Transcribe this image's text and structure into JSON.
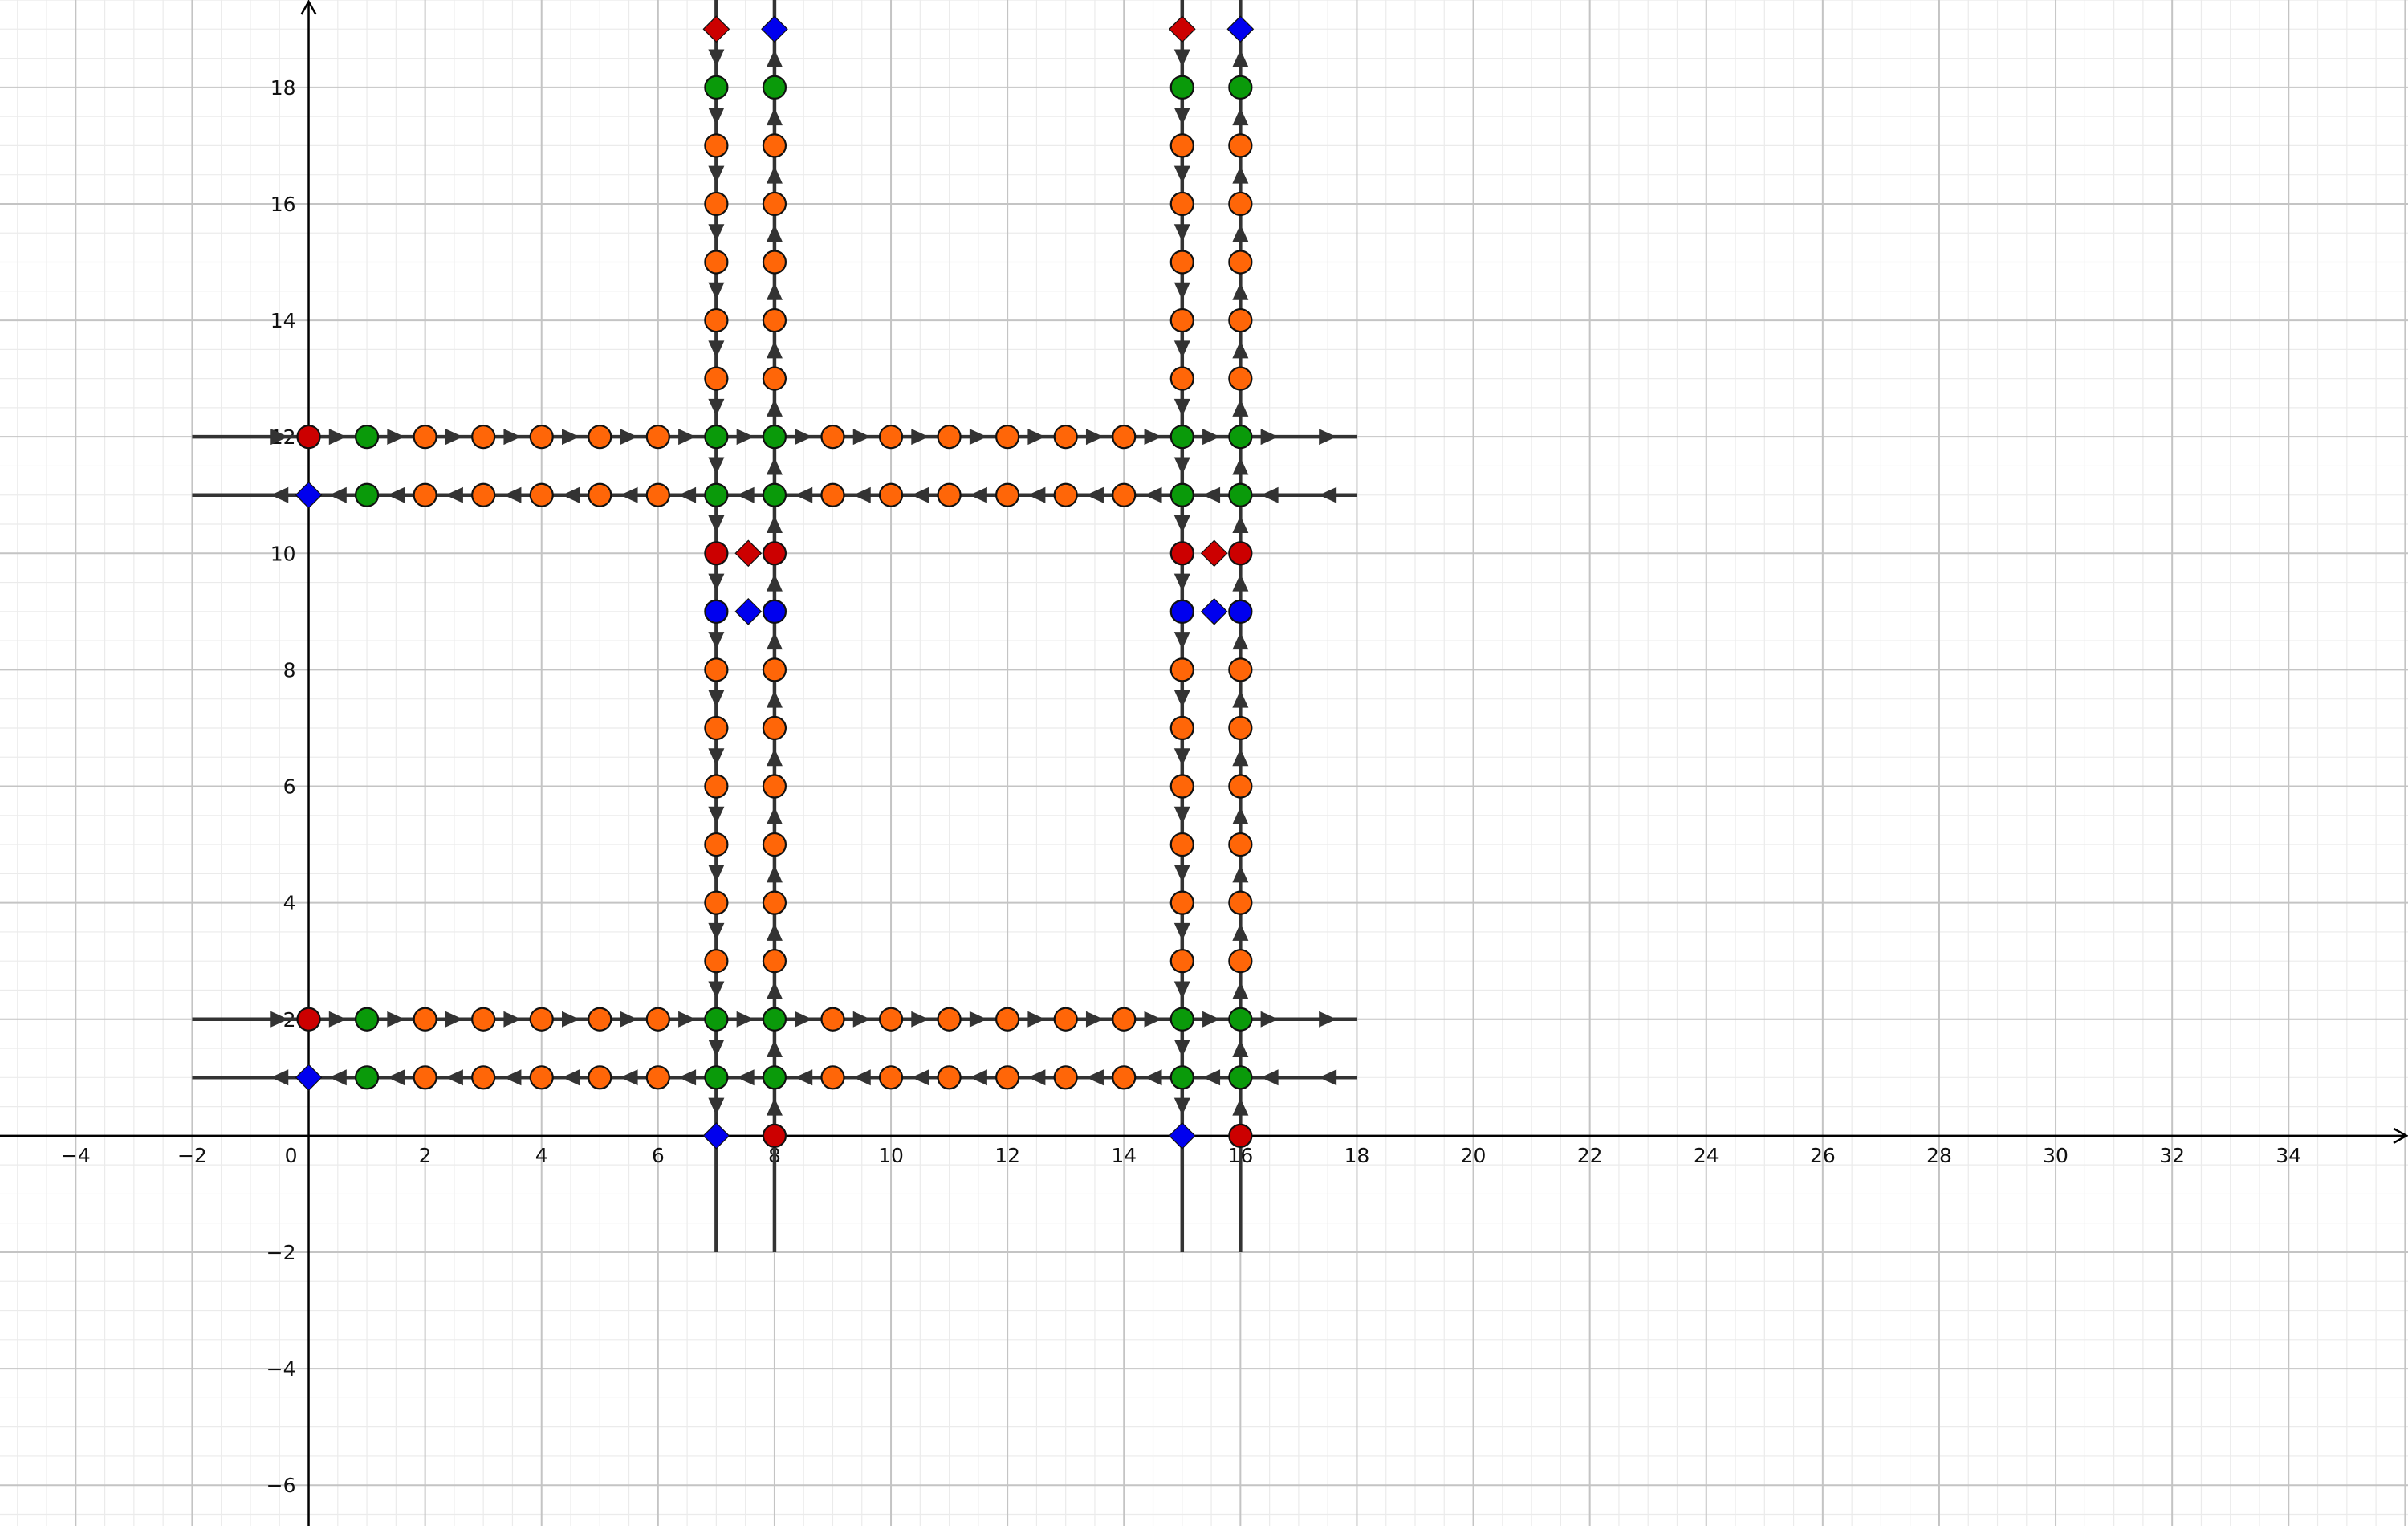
{
  "view": {
    "x_range": [
      -5.3,
      36.05
    ],
    "y_range": [
      -6.7,
      19.5
    ]
  },
  "axes": {
    "x_ticks": [
      -4,
      -2,
      0,
      2,
      4,
      6,
      8,
      10,
      12,
      14,
      16,
      18,
      20,
      22,
      24,
      26,
      28,
      30,
      32,
      34
    ],
    "y_ticks": [
      -6,
      -4,
      -2,
      2,
      4,
      6,
      8,
      10,
      12,
      14,
      16,
      18
    ],
    "x_tick_labels": [
      "−4",
      "−2",
      "0",
      "2",
      "4",
      "6",
      "8",
      "10",
      "12",
      "14",
      "16",
      "18",
      "20",
      "22",
      "24",
      "26",
      "28",
      "30",
      "32",
      "34"
    ],
    "y_tick_labels": [
      "−6",
      "−4",
      "−2",
      "2",
      "4",
      "6",
      "8",
      "10",
      "12",
      "14",
      "16",
      "18"
    ],
    "major_grid": 2,
    "minor_grid": 0.5
  },
  "colors": {
    "background": "#ffffff",
    "minor_grid": "#ebebeb",
    "major_grid": "#c4c4c4",
    "axis": "#000000",
    "road": "#333333",
    "arrow": "#333333",
    "node_orange": "#ff6608",
    "node_green": "#0a9a0a",
    "node_red": "#cc0000",
    "node_blue": "#0000ee",
    "node_outline": "#111111"
  },
  "roads": {
    "horizontal": [
      {
        "y": 12,
        "x_from": -2,
        "x_to": 18,
        "direction": "east"
      },
      {
        "y": 11,
        "x_from": -2,
        "x_to": 18,
        "direction": "west"
      },
      {
        "y": 2,
        "x_from": -2,
        "x_to": 18,
        "direction": "east"
      },
      {
        "y": 1,
        "x_from": -2,
        "x_to": 18,
        "direction": "west"
      }
    ],
    "vertical": [
      {
        "x": 7,
        "y_from": -2,
        "y_to": 19.5,
        "direction": "south"
      },
      {
        "x": 8,
        "y_from": -2,
        "y_to": 19.5,
        "direction": "north"
      },
      {
        "x": 15,
        "y_from": -2,
        "y_to": 19.5,
        "direction": "south"
      },
      {
        "x": 16,
        "y_from": -2,
        "y_to": 19.5,
        "direction": "north"
      }
    ]
  },
  "nodes": {
    "green": [
      [
        1,
        12
      ],
      [
        7,
        12
      ],
      [
        8,
        12
      ],
      [
        15,
        12
      ],
      [
        16,
        12
      ],
      [
        1,
        11
      ],
      [
        7,
        11
      ],
      [
        8,
        11
      ],
      [
        15,
        11
      ],
      [
        16,
        11
      ],
      [
        1,
        2
      ],
      [
        7,
        2
      ],
      [
        8,
        2
      ],
      [
        15,
        2
      ],
      [
        16,
        2
      ],
      [
        1,
        1
      ],
      [
        7,
        1
      ],
      [
        8,
        1
      ],
      [
        15,
        1
      ],
      [
        16,
        1
      ],
      [
        7,
        18
      ],
      [
        8,
        18
      ],
      [
        15,
        18
      ],
      [
        16,
        18
      ]
    ],
    "red_circles": [
      [
        0,
        12
      ],
      [
        0,
        2
      ],
      [
        7,
        10
      ],
      [
        8,
        10
      ],
      [
        15,
        10
      ],
      [
        16,
        10
      ],
      [
        8,
        0
      ],
      [
        16,
        0
      ]
    ],
    "blue_circles": [
      [
        7,
        9
      ],
      [
        8,
        9
      ],
      [
        15,
        9
      ],
      [
        16,
        9
      ]
    ],
    "red_diamonds": [
      [
        7,
        19
      ],
      [
        15,
        19
      ],
      [
        7.55,
        10
      ],
      [
        15.55,
        10
      ]
    ],
    "blue_diamonds": [
      [
        8,
        19
      ],
      [
        16,
        19
      ],
      [
        0,
        11
      ],
      [
        0,
        1
      ],
      [
        7.55,
        9
      ],
      [
        15.55,
        9
      ],
      [
        7,
        0
      ],
      [
        15,
        0
      ]
    ]
  }
}
